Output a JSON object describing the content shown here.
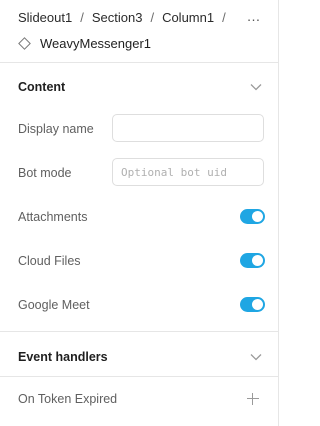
{
  "breadcrumb": [
    "Slideout1",
    "Section3",
    "Column1"
  ],
  "breadcrumb_separator": "/",
  "more_icon": "…",
  "component": {
    "icon": "diamond-icon",
    "name": "WeavyMessenger1"
  },
  "content_section": {
    "title": "Content",
    "display_name": {
      "label": "Display name",
      "value": "",
      "placeholder": ""
    },
    "bot_mode": {
      "label": "Bot mode",
      "value": "",
      "placeholder": "Optional bot uid"
    },
    "toggles": [
      {
        "label": "Attachments",
        "on": true
      },
      {
        "label": "Cloud Files",
        "on": true
      },
      {
        "label": "Google Meet",
        "on": true
      }
    ]
  },
  "event_handlers_section": {
    "title": "Event handlers",
    "items": [
      {
        "label": "On Token Expired"
      }
    ]
  },
  "colors": {
    "accent": "#1fa6e3",
    "divider": "#e6e6e6",
    "label": "#606060"
  }
}
